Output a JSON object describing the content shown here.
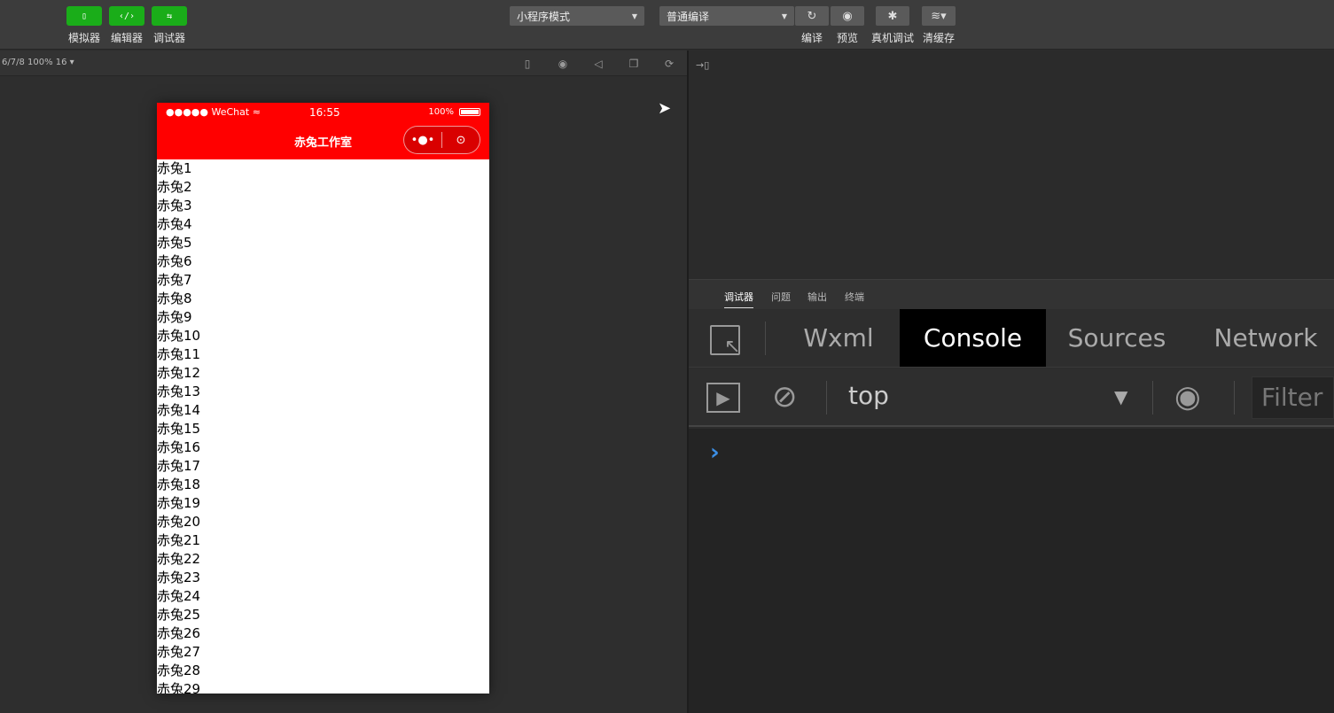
{
  "toolbar": {
    "left_buttons": [
      {
        "icon": "phone-icon",
        "glyph": "▯",
        "label": "模拟器"
      },
      {
        "icon": "code-icon",
        "glyph": "‹/›",
        "label": "编辑器"
      },
      {
        "icon": "debug-icon",
        "glyph": "⇆",
        "label": "调试器"
      }
    ],
    "mode_select": "小程序模式",
    "compile_select": "普通编译",
    "actions": [
      {
        "icon": "refresh-icon",
        "glyph": "↻",
        "label": "编译"
      },
      {
        "icon": "eye-icon",
        "glyph": "◉",
        "label": "预览"
      },
      {
        "icon": "bug-icon",
        "glyph": "✱",
        "label": "真机调试"
      },
      {
        "icon": "layers-icon",
        "glyph": "≋▾",
        "label": "清缓存"
      }
    ]
  },
  "simulator": {
    "device_info": "6/7/8 100% 16 ▾"
  },
  "phone": {
    "carrier": "●●●●● WeChat",
    "time": "16:55",
    "battery": "100%",
    "battery_level": 1.0,
    "nav_title": "赤兔工作室",
    "items": [
      "赤兔1",
      "赤兔2",
      "赤兔3",
      "赤兔4",
      "赤兔5",
      "赤兔6",
      "赤兔7",
      "赤兔8",
      "赤兔9",
      "赤兔10",
      "赤兔11",
      "赤兔12",
      "赤兔13",
      "赤兔14",
      "赤兔15",
      "赤兔16",
      "赤兔17",
      "赤兔18",
      "赤兔19",
      "赤兔20",
      "赤兔21",
      "赤兔22",
      "赤兔23",
      "赤兔24",
      "赤兔25",
      "赤兔26",
      "赤兔27",
      "赤兔28",
      "赤兔29"
    ]
  },
  "debug_tabs": [
    "调试器",
    "问题",
    "输出",
    "终端"
  ],
  "devtools": {
    "tabs": [
      "Wxml",
      "Console",
      "Sources",
      "Network"
    ],
    "active_tab": "Console",
    "context": "top",
    "filter_placeholder": "Filter",
    "prompt": "›"
  }
}
